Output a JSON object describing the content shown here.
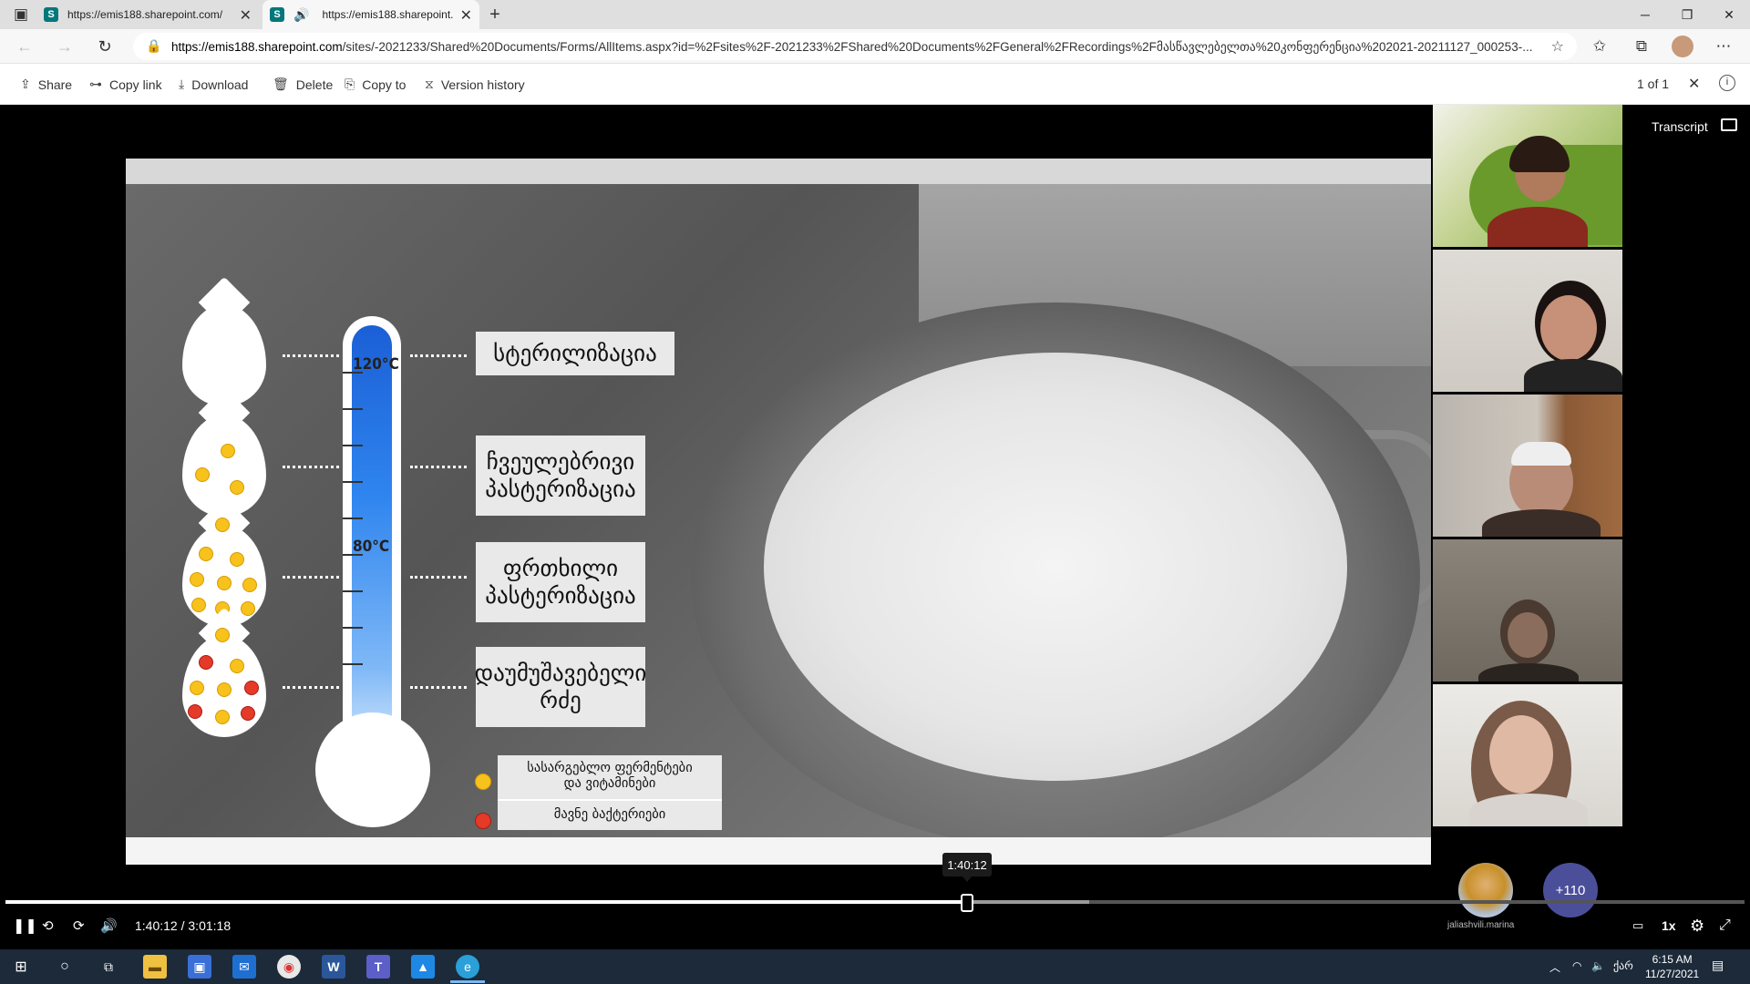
{
  "browser": {
    "tabs": [
      {
        "title": "https://emis188.sharepoint.com/",
        "favicon": "S",
        "active": false
      },
      {
        "title": "https://emis188.sharepoint.",
        "favicon": "S",
        "active": true,
        "audio": true
      }
    ],
    "new_tab": "+",
    "window_controls": {
      "minimize": "─",
      "restore": "❐",
      "close": "✕"
    },
    "url_domain": "https://emis188.sharepoint.com",
    "url_rest": "/sites/-2021233/Shared%20Documents/Forms/AllItems.aspx?id=%2Fsites%2F-2021233%2FShared%20Documents%2FGeneral%2FRecordings%2Fმასწავლებელთა%20კონფერენცია%202021-20211127_000253-..."
  },
  "commands": {
    "share": "Share",
    "copy_link": "Copy link",
    "download": "Download",
    "delete": "Delete",
    "copy_to": "Copy to",
    "version_history": "Version history",
    "page_count": "1 of 1"
  },
  "video": {
    "thermometer": {
      "t120": "120°C",
      "t80": "80°C"
    },
    "labels": {
      "sterilization": "სტერილიზაცია",
      "regular_1": "ჩვეულებრივი",
      "regular_2": "პასტერიზაცია",
      "gentle_1": "ფრთხილი",
      "gentle_2": "პასტერიზაცია",
      "raw_1": "დაუმუშავებელი",
      "raw_2": "რძე"
    },
    "legend": {
      "useful_1": "სასარგებლო ფერმენტები",
      "useful_2": "და ვიტამინები",
      "harmful": "მავნე ბაქტერიები"
    }
  },
  "side": {
    "transcript": "Transcript",
    "avatar_name": "jaliashvili.marina",
    "more_count": "+110"
  },
  "player": {
    "tooltip": "1:40:12",
    "current": "1:40:12",
    "separator": "/",
    "duration": "3:01:18",
    "speed": "1x",
    "progress": 0.553
  },
  "taskbar": {
    "time": "6:15 AM",
    "date": "11/27/2021",
    "lang": "ქარ"
  }
}
